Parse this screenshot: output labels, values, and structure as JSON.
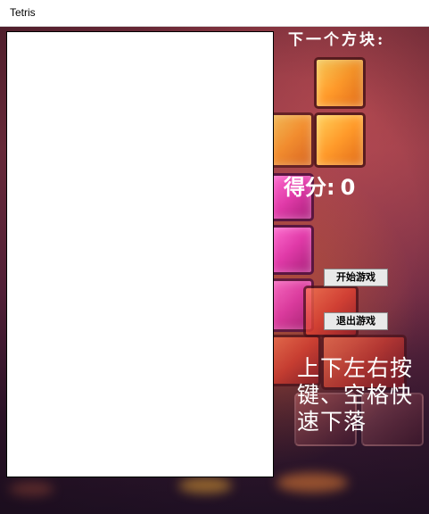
{
  "window": {
    "title": "Tetris"
  },
  "sidebar": {
    "next_label": "下一个方块:",
    "score_label": "得分:",
    "score_value": "0",
    "start_button": "开始游戏",
    "exit_button": "退出游戏",
    "help_text": "上下左右按键、空格快速下落"
  },
  "colors": {
    "board": "#ffffff",
    "text": "#ffffff",
    "button_bg": "#e9e9e9"
  }
}
